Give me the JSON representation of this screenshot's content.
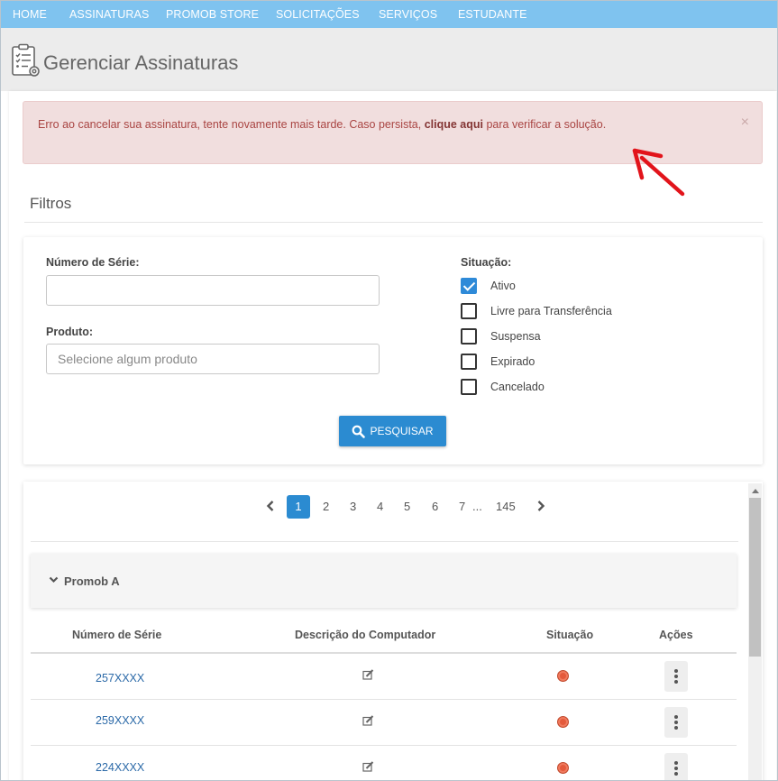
{
  "nav": {
    "items": [
      "HOME",
      "ASSINATURAS",
      "PROMOB STORE",
      "SOLICITAÇÕES",
      "SERVIÇOS",
      "ESTUDANTE"
    ]
  },
  "header": {
    "title": "Gerenciar Assinaturas",
    "icon": "clipboard-checklist-icon"
  },
  "alert": {
    "text_before": "Erro ao cancelar sua assinatura, tente novamente mais tarde. Caso persista, ",
    "link": "clique aqui",
    "text_after": " para verificar a solução.",
    "close": "×",
    "color": "#a94442",
    "background": "#f1dede"
  },
  "filters": {
    "title": "Filtros",
    "serial_label": "Número de Série:",
    "serial_value": "",
    "product_label": "Produto:",
    "product_placeholder": "Selecione algum produto",
    "status_label": "Situação:",
    "status_options": [
      {
        "label": "Ativo",
        "checked": true
      },
      {
        "label": "Livre para Transferência",
        "checked": false
      },
      {
        "label": "Suspensa",
        "checked": false
      },
      {
        "label": "Expirado",
        "checked": false
      },
      {
        "label": "Cancelado",
        "checked": false
      }
    ],
    "search_button": "PESQUISAR"
  },
  "pagination": {
    "current": "1",
    "pages": [
      "2",
      "3",
      "4",
      "5",
      "6",
      "7"
    ],
    "ellipsis": "...",
    "last": "145"
  },
  "results": {
    "group": "Promob A",
    "columns": [
      "Número de Série",
      "Descrição do Computador",
      "Situação",
      "Ações"
    ],
    "rows": [
      {
        "serial": "257XXXX"
      },
      {
        "serial": "259XXXX"
      },
      {
        "serial": "224XXXX"
      }
    ]
  },
  "colors": {
    "nav": "#7fc3ef",
    "primary": "#2b8bd1",
    "status_dot": "#e45a3c"
  }
}
